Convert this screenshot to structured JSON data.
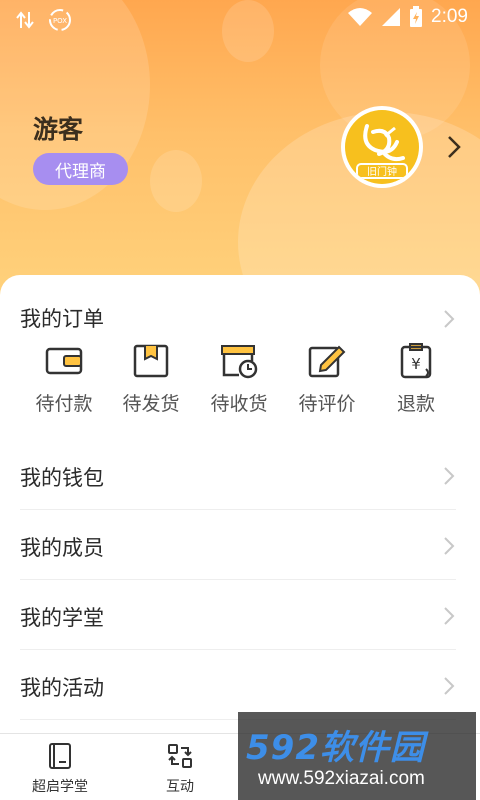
{
  "status_bar": {
    "time": "2:09",
    "icons": [
      "data-transfer-icon",
      "notification-icon",
      "wifi-icon",
      "signal-icon",
      "battery-charging-icon"
    ]
  },
  "profile": {
    "name": "游客",
    "role": "代理商",
    "avatar_icon": "avatar-logo-icon",
    "avatar_text": "旧门钟"
  },
  "orders": {
    "title": "我的订单",
    "items": [
      {
        "label": "待付款",
        "icon": "wallet-icon"
      },
      {
        "label": "待发货",
        "icon": "package-icon"
      },
      {
        "label": "待收货",
        "icon": "receive-clock-icon"
      },
      {
        "label": "待评价",
        "icon": "edit-icon"
      },
      {
        "label": "退款",
        "icon": "refund-icon"
      }
    ]
  },
  "menu": [
    {
      "label": "我的钱包"
    },
    {
      "label": "我的成员"
    },
    {
      "label": "我的学堂"
    },
    {
      "label": "我的活动"
    }
  ],
  "bottom_nav": [
    {
      "label": "超启学堂",
      "icon": "book-icon"
    },
    {
      "label": "互动",
      "icon": "exchange-icon"
    }
  ],
  "watermark": {
    "brand": "592软件园",
    "url": "www.592xiazai.com"
  },
  "colors": {
    "header_top": "#ffa74f",
    "header_bottom": "#ffd27c",
    "badge": "#a78ef0",
    "avatar": "#f7c01e"
  }
}
